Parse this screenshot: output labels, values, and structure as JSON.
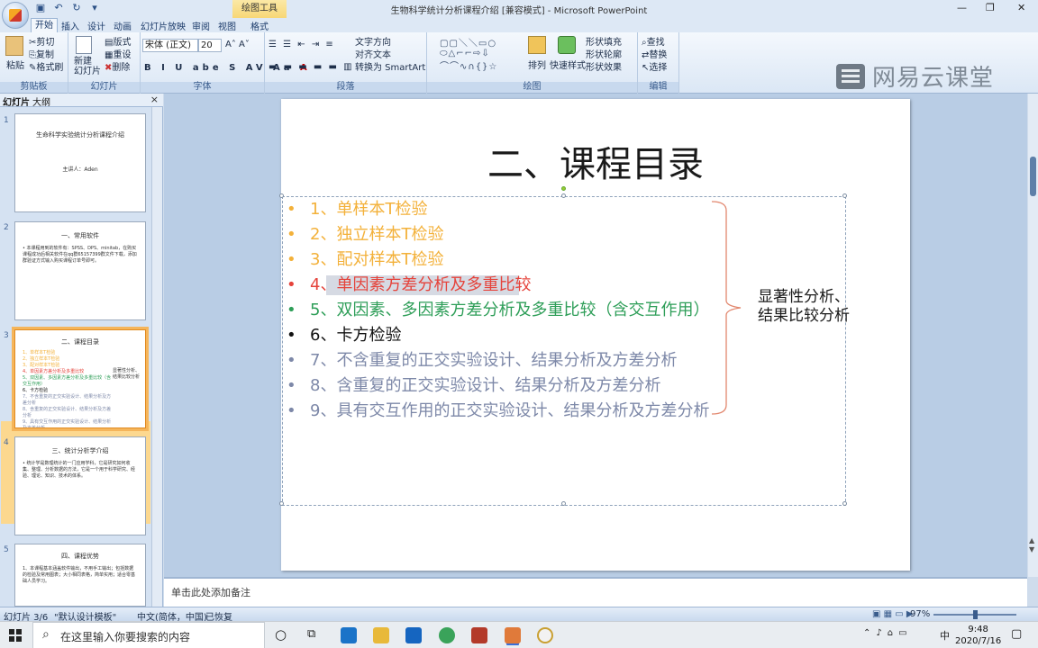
{
  "window": {
    "title": "生物科学统计分析课程介绍 [兼容模式] - Microsoft PowerPoint",
    "tools_label": "绘图工具",
    "minimize": "—",
    "restore": "❐",
    "close": "✕"
  },
  "tabs": [
    "开始",
    "插入",
    "设计",
    "动画",
    "幻灯片放映",
    "审阅",
    "视图",
    "格式"
  ],
  "ribbon": {
    "clipboard": {
      "label": "剪贴板",
      "paste": "粘贴",
      "cut": "剪切",
      "copy": "复制",
      "format_painter": "格式刷"
    },
    "slides": {
      "label": "幻灯片",
      "new_slide": "新建\n幻灯片",
      "layout": "版式",
      "reset": "重设",
      "delete": "删除"
    },
    "font": {
      "label": "字体",
      "font_name": "宋体 (正文)",
      "font_size": "20"
    },
    "paragraph": {
      "label": "段落",
      "text_direction": "文字方向",
      "align_text": "对齐文本",
      "smartart": "转换为 SmartArt"
    },
    "drawing": {
      "label": "绘图",
      "arrange": "排列",
      "quick_styles": "快速样式",
      "shape_fill": "形状填充",
      "shape_outline": "形状轮廓",
      "shape_effects": "形状效果"
    },
    "editing": {
      "label": "编辑",
      "find": "查找",
      "replace": "替换",
      "select": "选择"
    }
  },
  "brand": "网易云课堂",
  "pane": {
    "tab_slides": "幻灯片",
    "tab_outline": "大纲",
    "close": "×",
    "slides": [
      {
        "num": "1",
        "title": "生命科学实验统计分析课程介绍",
        "body": "主讲人：Aden"
      },
      {
        "num": "2",
        "title": "一、常用软件",
        "body": "• 本课程用到的软件有：SPSS、DPS、minitab，在购买课程成功后相关软件在qq群65157399群文件下载，添加群验证方式输入购买课程订单号即可。"
      },
      {
        "num": "3",
        "title": "二、课程目录",
        "body": ""
      },
      {
        "num": "4",
        "title": "三、统计分析学介绍",
        "body": "• 统计学是数理统计的一门应用学科，它是研究如何收集、整理、分析数据的方法，它是一个用于科学研究、经验、理论、知识、技术的体系。"
      },
      {
        "num": "5",
        "title": "四、课程优势",
        "body": "1、本课程基本涵盖软件输出，不用手工输出；包括数据的检验及常用图表；大小相同表格，简单实用；适合零基础人员学习。"
      }
    ]
  },
  "slide": {
    "title": "二、课程目录",
    "items": [
      {
        "bullet": "•",
        "text": "1、单样本T检验",
        "color": "#f3b13a"
      },
      {
        "bullet": "•",
        "text": "2、独立样本T检验",
        "color": "#f3b13a"
      },
      {
        "bullet": "•",
        "text": "3、配对样本T检验",
        "color": "#f3b13a"
      },
      {
        "bullet": "•",
        "text": "4、单因素方差分析及多重比较",
        "color": "#e5433b"
      },
      {
        "bullet": "•",
        "text": "5、双因素、多因素方差分析及多重比较（含交互作用）",
        "color": "#2e9e58"
      },
      {
        "bullet": "•",
        "text": "6、卡方检验",
        "color": "#111111"
      },
      {
        "bullet": "•",
        "text": "7、不含重复的正交实验设计、结果分析及方差分析",
        "color": "#7d88a8"
      },
      {
        "bullet": "•",
        "text": "8、含重复的正交实验设计、结果分析及方差分析",
        "color": "#7d88a8"
      },
      {
        "bullet": "•",
        "text": "9、具有交互作用的正交实验设计、结果分析及方差分析",
        "color": "#7d88a8"
      }
    ],
    "side_note": "显著性分析、结果比较分析"
  },
  "notes_placeholder": "单击此处添加备注",
  "status": {
    "slide_indicator": "幻灯片 3/6",
    "theme": "\"默认设计模板\"",
    "language": "中文(简体，中国)",
    "recovered": "已恢复",
    "zoom": "97%"
  },
  "taskbar": {
    "search_placeholder": "在这里输入你要搜索的内容",
    "time": "9:48",
    "date": "2020/7/16",
    "ime": "中"
  }
}
